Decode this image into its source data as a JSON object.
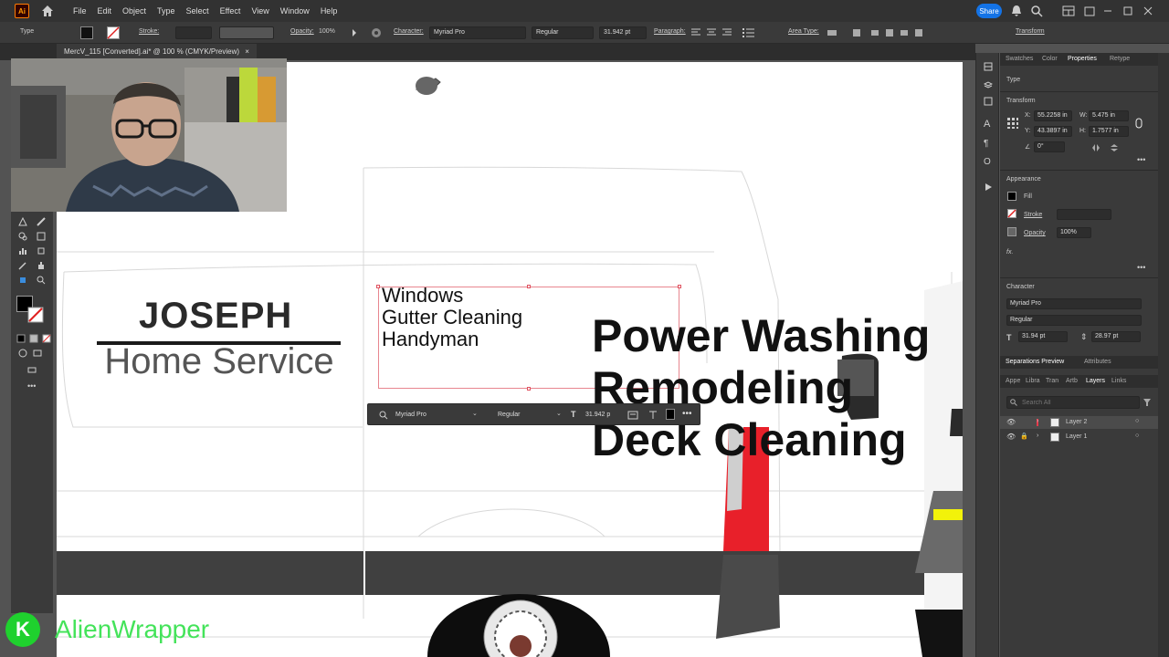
{
  "menubar": {
    "app_logo": "Ai",
    "items": [
      "File",
      "Edit",
      "Object",
      "Type",
      "Select",
      "Effect",
      "View",
      "Window",
      "Help"
    ],
    "share_label": "Share"
  },
  "controlbar": {
    "type_label": "Type",
    "stroke_label": "Stroke:",
    "opacity_label": "Opacity:",
    "opacity_value": "100%",
    "character_label": "Character:",
    "font_family": "Myriad Pro",
    "font_style": "Regular",
    "font_size": "31.942 pt",
    "paragraph_label": "Paragraph:",
    "area_type_label": "Area Type:",
    "transform_label": "Transform"
  },
  "document": {
    "tab_title": "MercV_115 [Converted].ai* @ 100 % (CMYK/Preview)"
  },
  "artwork": {
    "logo_title": "JOSEPH",
    "logo_subtitle": "Home Service",
    "services_small": [
      "Windows",
      "Gutter Cleaning",
      "Handyman"
    ],
    "services_big": [
      "Power Washing",
      "Remodeling",
      "Deck Cleaning"
    ]
  },
  "context_bar": {
    "font_family": "Myriad Pro",
    "font_style": "Regular",
    "font_size": "31.942 p"
  },
  "panel": {
    "tabs": [
      "Swatches",
      "Color",
      "Properties",
      "Retype"
    ],
    "active_tab": "Properties",
    "selection_type": "Type",
    "transform": {
      "heading": "Transform",
      "x_label": "X:",
      "x_value": "55.2258 in",
      "y_label": "Y:",
      "y_value": "43.3897 in",
      "w_label": "W:",
      "w_value": "5.475 in",
      "h_label": "H:",
      "h_value": "1.7577 in",
      "angle_value": "0°"
    },
    "appearance": {
      "heading": "Appearance",
      "fill_label": "Fill",
      "stroke_label": "Stroke",
      "opacity_label": "Opacity",
      "opacity_value": "100%",
      "fx_label": "fx."
    },
    "character": {
      "heading": "Character",
      "font_family": "Myriad Pro",
      "font_style": "Regular",
      "font_size": "31.94 pt",
      "leading": "28.97 pt"
    }
  },
  "bottom_panel": {
    "tabs_top": [
      "Separations Preview",
      "Attributes"
    ],
    "tabs": [
      "Appe",
      "Libra",
      "Tran",
      "Artb",
      "Layers",
      "Links"
    ],
    "active_tab": "Layers",
    "search_placeholder": "Search All",
    "layers": [
      {
        "name": "Layer 2",
        "color": "#e8394b",
        "selected": true
      },
      {
        "name": "Layer 1",
        "color": "#4a7fff",
        "selected": false
      }
    ]
  },
  "watermark": {
    "badge_letter": "K",
    "brand_name": "AlienWrapper"
  },
  "colors": {
    "accent": "#1473e6",
    "selection": "#e05260",
    "brand_green": "#44e35a",
    "van_red": "#e8202a",
    "van_yellow": "#f2f20a"
  }
}
